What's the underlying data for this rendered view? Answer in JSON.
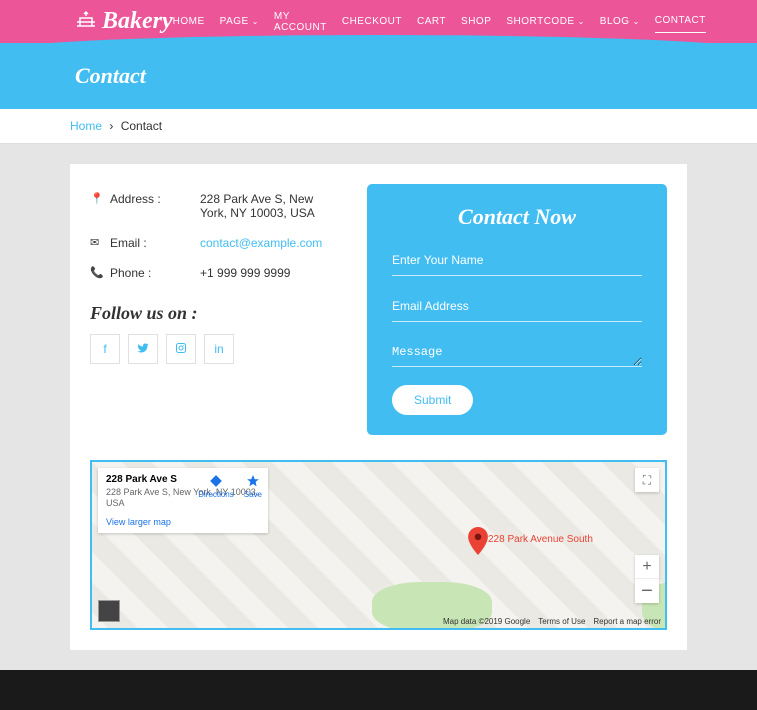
{
  "brand": "Bakery",
  "nav": {
    "home": "HOME",
    "page": "PAGE",
    "myaccount": "MY ACCOUNT",
    "checkout": "CHECKOUT",
    "cart": "CART",
    "shop": "SHOP",
    "shortcode": "SHORTCODE",
    "blog": "BLOG",
    "contact": "CONTACT"
  },
  "banner": {
    "title": "Contact"
  },
  "breadcrumb": {
    "home": "Home",
    "current": "Contact"
  },
  "info": {
    "address_label": "Address :",
    "address_value": "228 Park Ave S, New York, NY 10003, USA",
    "email_label": "Email :",
    "email_value": "contact@example.com",
    "phone_label": "Phone :",
    "phone_value": "+1 999 999 9999"
  },
  "follow_heading": "Follow us on :",
  "form": {
    "heading": "Contact Now",
    "name_placeholder": "Enter Your Name",
    "email_placeholder": "Email Address",
    "message_placeholder": "Message",
    "submit": "Submit"
  },
  "map": {
    "info_title": "228 Park Ave S",
    "info_address": "228 Park Ave S, New York, NY 10003, USA",
    "directions": "Directions",
    "save": "Save",
    "view_larger": "View larger map",
    "pin_label": "228 Park Avenue South",
    "attribution": "Map data ©2019 Google",
    "terms": "Terms of Use",
    "report": "Report a map error",
    "zoom_in": "+",
    "zoom_out": "−"
  }
}
